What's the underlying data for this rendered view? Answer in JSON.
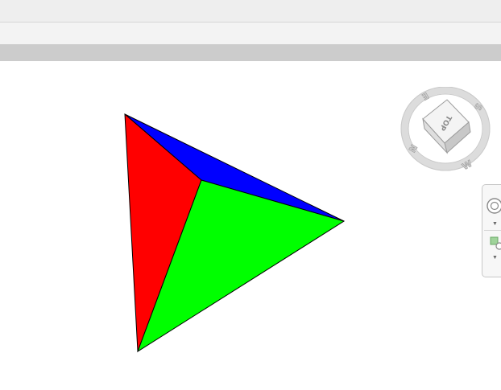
{
  "viewcube": {
    "face": "TOP",
    "compass": {
      "north": "N",
      "south": "S",
      "east": "E",
      "west": "W"
    }
  },
  "colors": {
    "face_left": "#ff0000",
    "face_right": "#00ff00",
    "face_top": "#0000ff",
    "edge": "#000000"
  },
  "navigation_bar": {
    "tools": [
      {
        "icon": "full-navigation-wheel-icon",
        "expand_icon": "chevron-down-icon"
      },
      {
        "icon": "zoom-extents-icon",
        "expand_icon": "chevron-down-icon"
      }
    ]
  }
}
